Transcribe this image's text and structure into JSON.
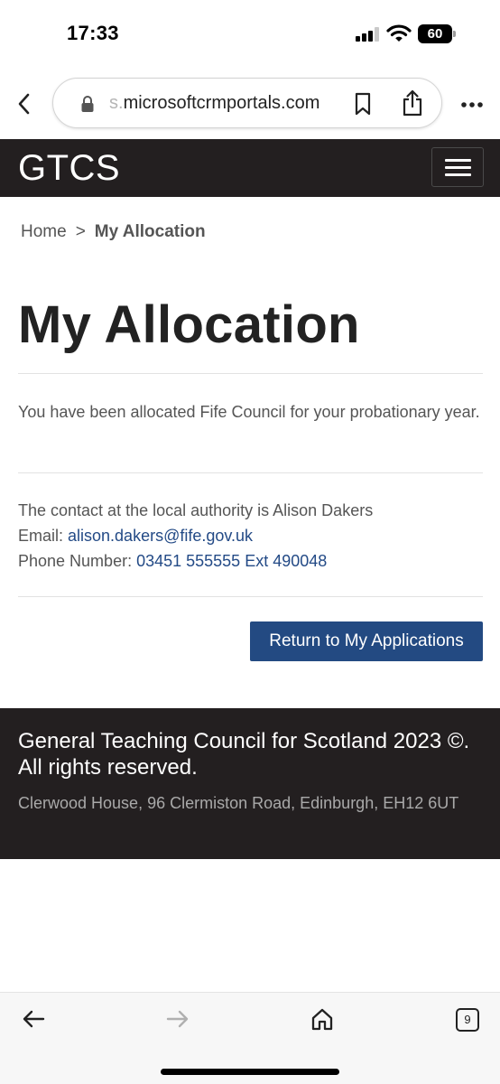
{
  "status_bar": {
    "time": "17:33",
    "battery_level": "60"
  },
  "browser": {
    "url_faded": "s.",
    "url_main": "microsoftcrmportals.com",
    "open_tabs_count": "9"
  },
  "site": {
    "brand": "GTCS"
  },
  "breadcrumb": {
    "home_label": "Home",
    "separator": ">",
    "current_label": "My Allocation"
  },
  "main": {
    "title": "My Allocation",
    "allocation_text": "You have been allocated Fife Council for your probationary year.",
    "contact_line": "The contact at the local authority is Alison Dakers",
    "email_label": "Email: ",
    "email_value": "alison.dakers@fife.gov.uk",
    "phone_label": "Phone Number: ",
    "phone_value": "03451 555555 Ext 490048",
    "return_button_label": "Return to My Applications"
  },
  "footer": {
    "title": "General Teaching Council for Scotland 2023 ©. All rights reserved.",
    "address": "Clerwood House, 96 Clermiston Road, Edinburgh, EH12 6UT"
  },
  "icons": {
    "status": [
      "signal-icon",
      "wifi-icon",
      "battery-icon"
    ],
    "browser": [
      "back-chevron-icon",
      "lock-icon",
      "bookmark-icon",
      "share-icon",
      "more-icon"
    ],
    "header": [
      "hamburger-menu-icon"
    ],
    "toolbar": [
      "arrow-left-icon",
      "arrow-right-icon",
      "home-icon",
      "tabs-icon"
    ]
  },
  "colors": {
    "header_bg": "#231f20",
    "button_bg": "#234a82",
    "link": "#234a86",
    "body_text": "#555555"
  }
}
